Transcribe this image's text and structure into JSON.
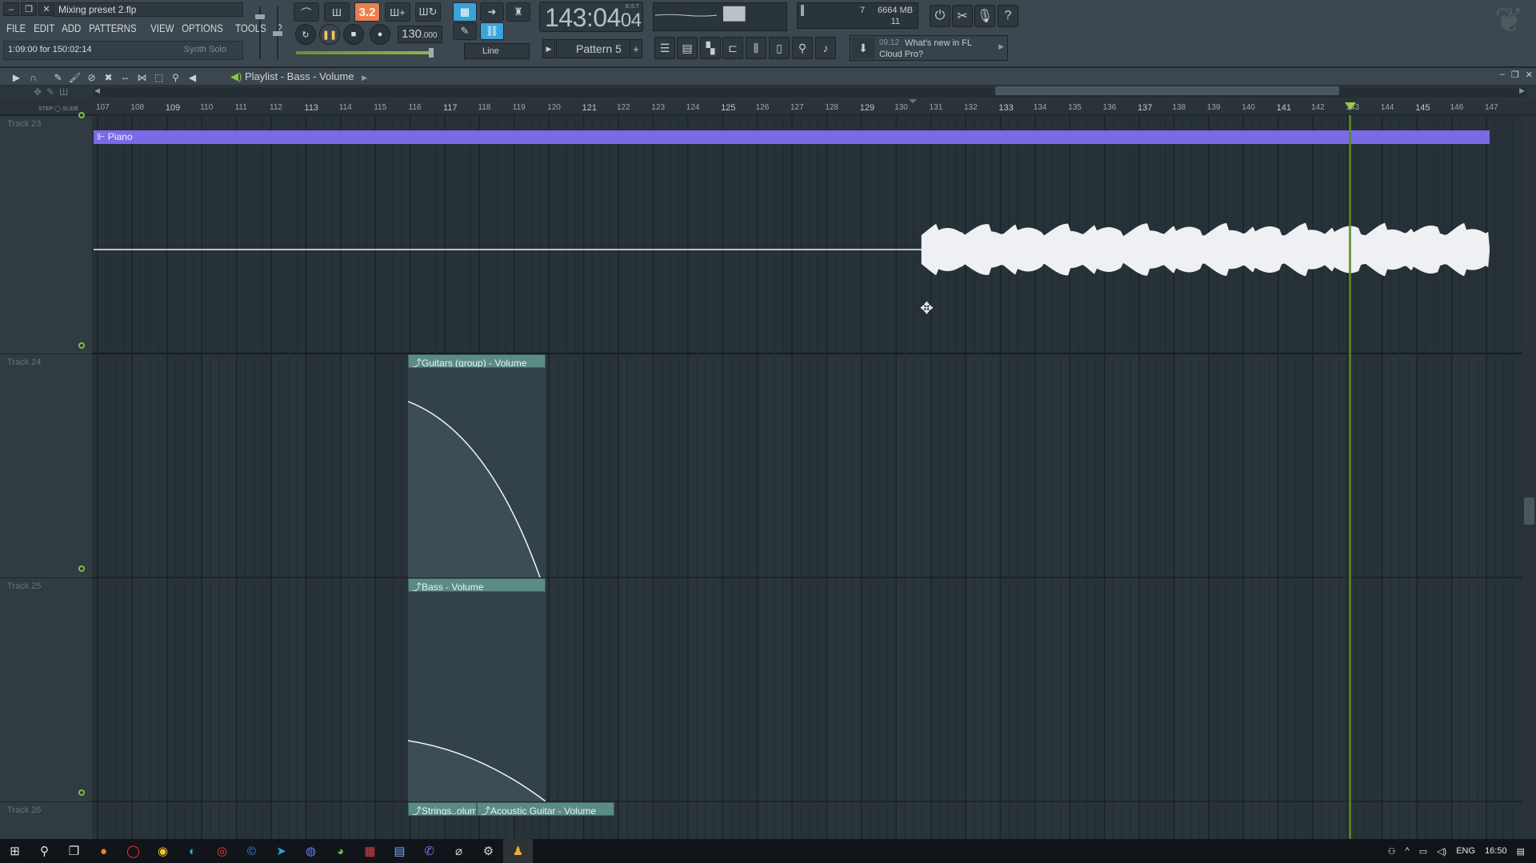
{
  "window": {
    "filename": "Mixing preset 2.flp",
    "hint_text": "1:09:00 for 150:02:14",
    "hint_right": "Synth Solo"
  },
  "menu": [
    "FILE",
    "EDIT",
    "ADD",
    "PATTERNS",
    "VIEW",
    "OPTIONS",
    "TOOLS",
    "?"
  ],
  "transport": {
    "tempo": "130",
    "tempo_decimal": ".000",
    "time_main": "143:04",
    "time_sub": "04",
    "time_label": "B:S:T",
    "pattern": "Pattern 5",
    "snap": "Line"
  },
  "meters": {
    "cpu_value": "7",
    "memory": "6664 MB",
    "polyphony": "11"
  },
  "news": {
    "date": "09.12",
    "title_line1": "What's new in FL",
    "title_line2": "Cloud Pro?"
  },
  "playlist": {
    "title": "Playlist - Bass - Volume",
    "step_label": "STEP",
    "slide_label": "SLIDE",
    "bars": [
      "107",
      "108",
      "109",
      "110",
      "111",
      "112",
      "113",
      "114",
      "115",
      "116",
      "117",
      "118",
      "119",
      "120",
      "121",
      "122",
      "123",
      "124",
      "125",
      "126",
      "127",
      "128",
      "129",
      "130",
      "131",
      "132",
      "133",
      "134",
      "135",
      "136",
      "137",
      "138",
      "139",
      "140",
      "141",
      "142",
      "143",
      "144",
      "145",
      "146",
      "147"
    ],
    "playhead_bar": 143.0,
    "tracks": [
      {
        "name": "Track 23"
      },
      {
        "name": "Track 24"
      },
      {
        "name": "Track 25"
      },
      {
        "name": "Track 26"
      }
    ],
    "clips": {
      "piano": "Piano",
      "guitars": "Guitars (group) - Volume",
      "bass": "Bass - Volume",
      "strings": "Strings..olume",
      "acoustic": "Acoustic Guitar - Volume"
    }
  },
  "taskbar": {
    "lang": "ENG",
    "clock": "16:50"
  },
  "colors": {
    "audio_clip": "#7b6ae6",
    "automation_clip": "#5c8a84",
    "playhead": "#9ad02c",
    "accent_orange": "#e87f4e",
    "accent_blue": "#3aa3d8"
  }
}
